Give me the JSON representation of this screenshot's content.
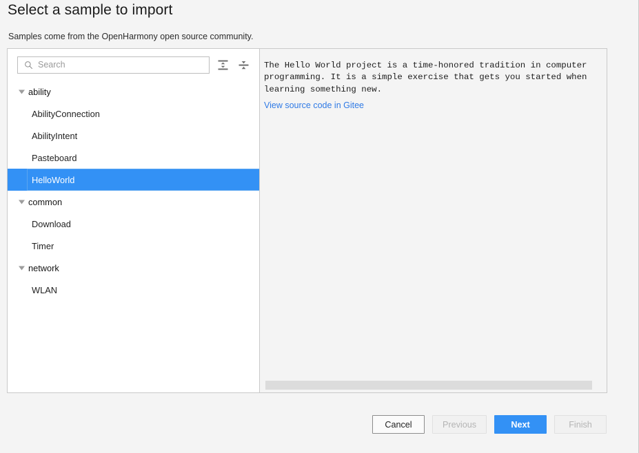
{
  "header": {
    "title": "Select a sample to import",
    "subtitle": "Samples come from the OpenHarmony open source community."
  },
  "search": {
    "placeholder": "Search",
    "value": "",
    "icon": "search-icon"
  },
  "tree_toolbar": {
    "expand_all": {
      "tooltip": "Expand All",
      "icon": "expand-all-icon"
    },
    "collapse_all": {
      "tooltip": "Collapse All",
      "icon": "collapse-all-icon"
    }
  },
  "tree": {
    "groups": [
      {
        "label": "ability",
        "expanded": true,
        "children": [
          {
            "label": "AbilityConnection",
            "selected": false
          },
          {
            "label": "AbilityIntent",
            "selected": false
          },
          {
            "label": "Pasteboard",
            "selected": false
          },
          {
            "label": "HelloWorld",
            "selected": true
          }
        ]
      },
      {
        "label": "common",
        "expanded": true,
        "children": [
          {
            "label": "Download",
            "selected": false
          },
          {
            "label": "Timer",
            "selected": false
          }
        ]
      },
      {
        "label": "network",
        "expanded": true,
        "children": [
          {
            "label": "WLAN",
            "selected": false
          }
        ]
      }
    ]
  },
  "details": {
    "description": "The Hello World project is a time-honored tradition in computer\nprogramming. It is a simple exercise that gets you started when\nlearning something new.",
    "link_label": "View source code in Gitee"
  },
  "footer": {
    "cancel_label": "Cancel",
    "previous_label": "Previous",
    "next_label": "Next",
    "finish_label": "Finish"
  },
  "colors": {
    "accent": "#3391f5",
    "link": "#2f7ae5",
    "panel_bg": "#f4f4f4",
    "disabled_text": "#b4b4b4"
  }
}
